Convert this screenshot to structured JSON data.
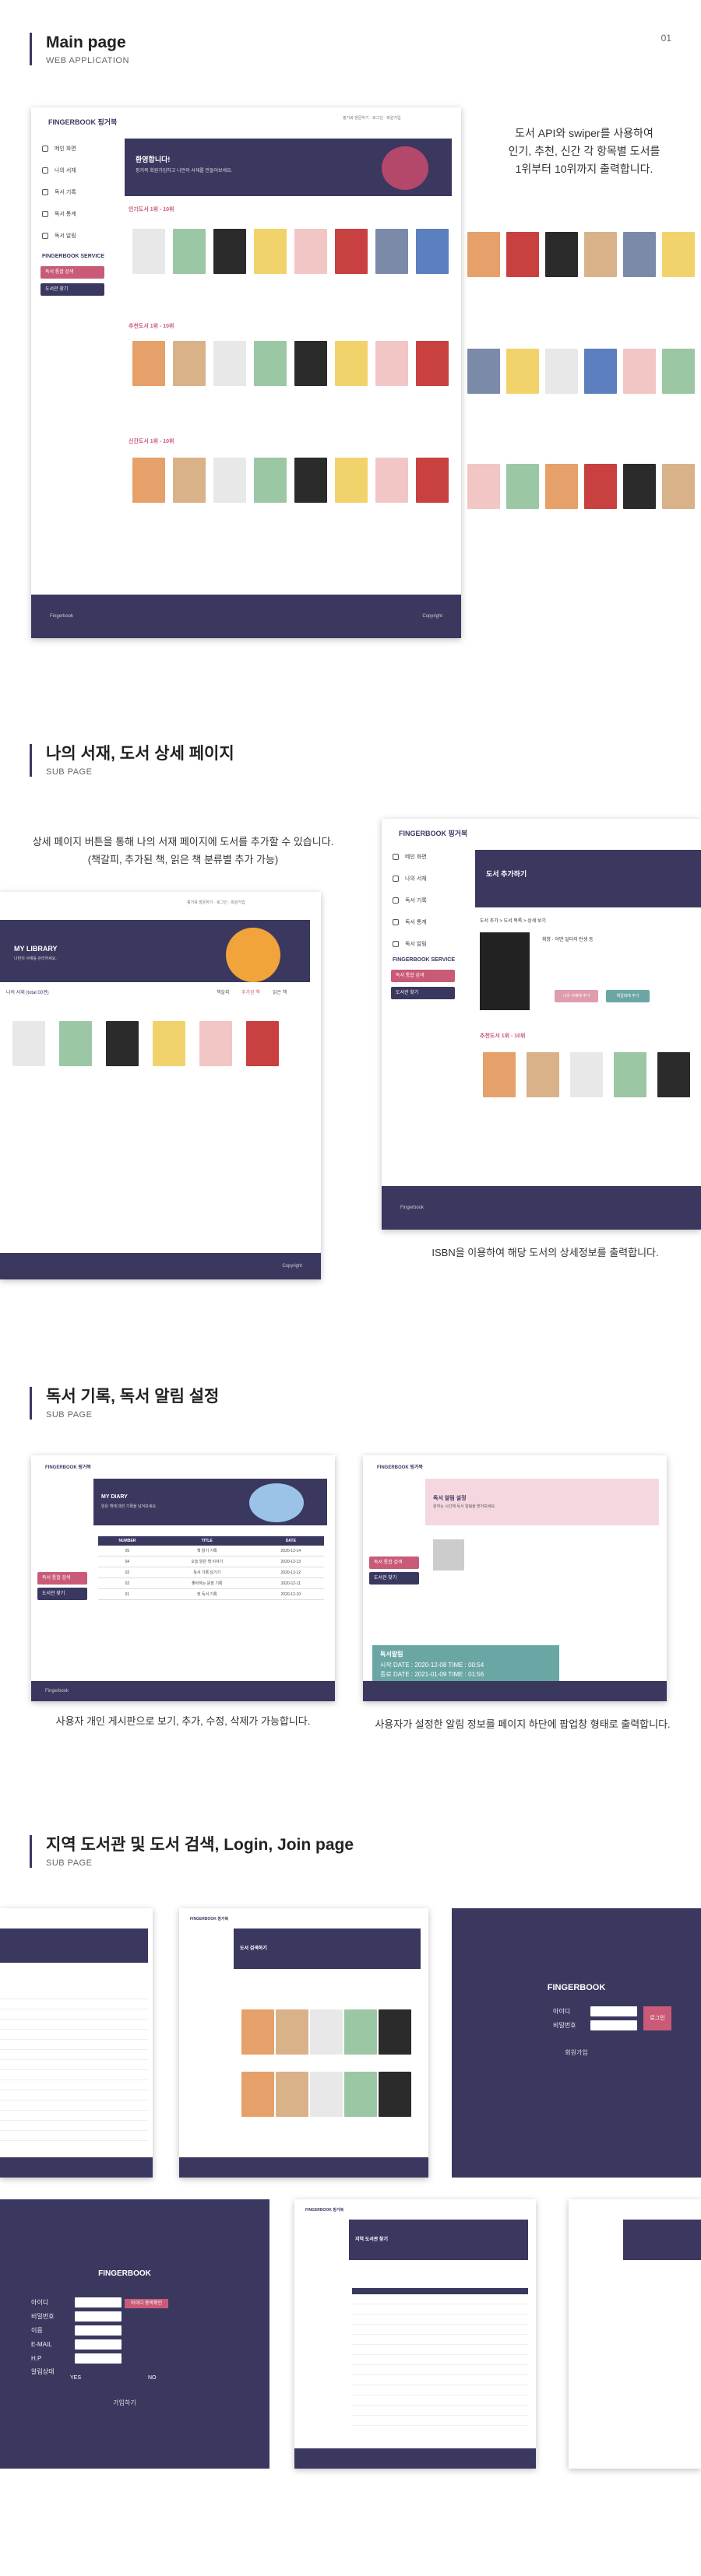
{
  "page_number": "01",
  "colors": {
    "navy": "#3b3860",
    "pink": "#c95b78",
    "accent_orange": "#f0a43a"
  },
  "section1": {
    "title": "Main page",
    "subtitle": "WEB APPLICATION",
    "desc_lines": [
      "도서 API와 swiper를 사용하여",
      "인기, 추천, 신간 각 항목별 도서를",
      "1위부터 10위까지 출력합니다."
    ],
    "app": {
      "logo": "FINGERBOOK 핑거북",
      "topnav": "핑거북 방문하기 · 로그인 · 회원가입",
      "menu": [
        "메인 화면",
        "나의 서재",
        "독서 기록",
        "독서 통계",
        "독서 알림"
      ],
      "service_label": "FINGERBOOK SERVICE",
      "service_buttons": [
        "독서 통합 검색",
        "도서관 찾기"
      ],
      "banner_title": "환영합니다!",
      "banner_text": "핑거북 회원가입하고 나만의 서재를 만들어보세요.",
      "rows": [
        "인기도서 1위 - 10위",
        "추천도서 1위 - 10위",
        "신간도서 1위 - 10위"
      ],
      "footer_left": "Fingerbook",
      "footer_right": "Copyright"
    }
  },
  "section2": {
    "title": "나의 서재, 도서 상세 페이지",
    "subtitle": "SUB PAGE",
    "desc_lines": [
      "상세 페이지 버튼을 통해 나의 서재 페이지에 도서를 추가할 수 있습니다.",
      "(책갈피, 추가된 책, 읽은 책 분류별 추가 가능)"
    ],
    "desc2": "ISBN을 이용하여 해당 도서의 상세정보를 출력합니다.",
    "library": {
      "banner_title": "MY LIBRARY",
      "banner_text": "나만의 서재를 관리하세요.",
      "list_label": "나의 서재 (total 00권)",
      "tabs": [
        "책갈피",
        "추가된 책",
        "읽은 책"
      ],
      "footer_right": "Copyright"
    },
    "detail": {
      "logo": "FINGERBOOK 핑거북",
      "banner_title": "도서 추가하기",
      "breadcrumb": "도서 추가 > 도서 목록 > 상세 보기",
      "book_title": "취향 · 어떤 일터의 탄생 등",
      "buttons": [
        "나의 서재에 추가",
        "책갈피에 추가"
      ],
      "rec_label": "추천도서 1위 - 10위",
      "footer_left": "Fingerbook"
    }
  },
  "section3": {
    "title": "독서 기록, 독서 알림 설정",
    "subtitle": "SUB PAGE",
    "desc_left": "사용자 개인 게시판으로 보기, 추가, 수정, 삭제가 가능합니다.",
    "desc_right": "사용자가 설정한 알림 정보를 페이지 하단에 팝업창 형태로 출력합니다.",
    "diary": {
      "banner_title": "MY DIARY",
      "banner_text": "읽은 책에 대한 기록을 남겨보세요.",
      "columns": [
        "NUMBER",
        "TITLE",
        "DATE"
      ],
      "rows": [
        [
          "05",
          "책 읽기 기록",
          "2020-12-14"
        ],
        [
          "04",
          "오늘 읽은 책 이야기",
          "2020-12-13"
        ],
        [
          "03",
          "독서 기록 남기기",
          "2020-12-12"
        ],
        [
          "02",
          "좋아하는 문장 기록",
          "2020-12-11"
        ],
        [
          "01",
          "첫 독서 기록",
          "2020-12-10"
        ]
      ]
    },
    "alarm": {
      "banner_title": "독서 알림 설정",
      "banner_text": "원하는 시간에 독서 알림을 받아보세요.",
      "popup_title": "독서알림",
      "popup_line1": "시작  DATE : 2020-12-08  TIME : 00:54",
      "popup_line2": "종료  DATE : 2021-01-09  TIME : 01:56"
    }
  },
  "section4": {
    "title": "지역 도서관 및 도서 검색, Login, Join page",
    "subtitle": "SUB PAGE",
    "login": {
      "logo": "FINGERBOOK",
      "id_label": "아이디",
      "pw_label": "비밀번호",
      "login_btn": "로그인",
      "join_link": "회원가입"
    },
    "join": {
      "logo": "FINGERBOOK",
      "labels": [
        "아이디",
        "비밀번호",
        "이름",
        "E-MAIL",
        "H.P",
        "알림상태"
      ],
      "dup_btn": "아이디 중복확인",
      "notice_yes": "YES",
      "notice_no": "NO",
      "submit": "가입하기"
    },
    "search_banner": "도서 검색하기",
    "library_banner": "지역 도서관 찾기"
  }
}
